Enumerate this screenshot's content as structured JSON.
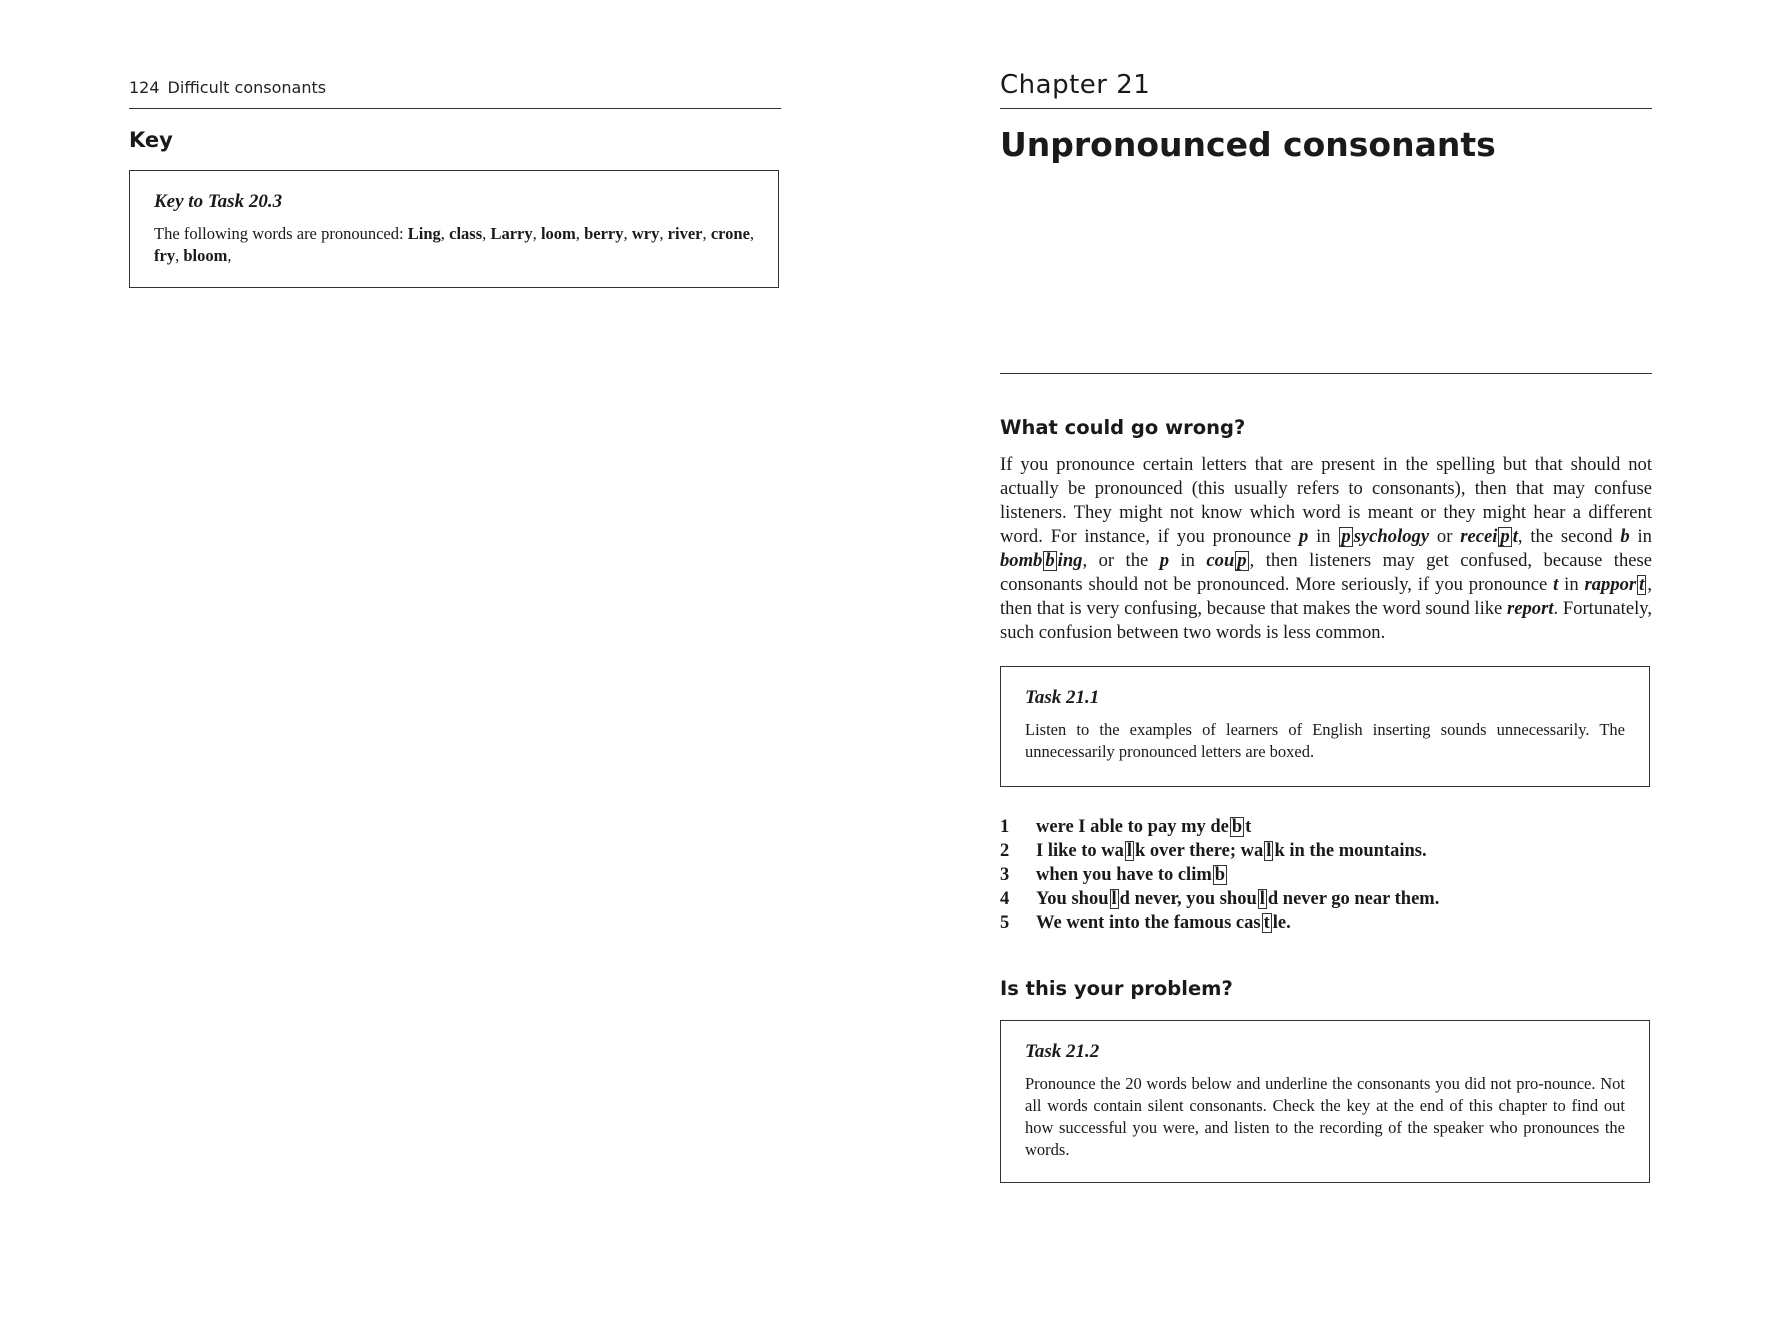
{
  "left_page": {
    "running_head": {
      "page_number": "124",
      "title": "Difficult consonants"
    },
    "key_heading": "Key",
    "key_box": {
      "title": "Key to Task 20.3",
      "intro": "The following words are pronounced: ",
      "words": [
        "Ling",
        "class",
        "Larry",
        "loom",
        "berry",
        "wry",
        "river",
        "crone",
        "fry",
        "bloom"
      ]
    }
  },
  "right_page": {
    "chapter_label": "Chapter 21",
    "chapter_title": "Unpronounced consonants",
    "section1_heading": "What could go wrong?",
    "body": {
      "t1": "If you pronounce certain letters that are present in the spelling but that should not actually be pronounced (this usually refers to consonants), then that may confuse listeners. They might not know which word is meant or they might hear a different word. For instance, if you pronounce ",
      "p1": "p",
      "t2": " in ",
      "w1_box": "p",
      "w1_rest": "sychology",
      "t3": " or ",
      "w2_a": "recei",
      "w2_box": "p",
      "w2_b": "t",
      "t4": ", the second ",
      "b1": "b",
      "t5": " in ",
      "w3_a": "bomb",
      "w3_box": "b",
      "w3_b": "ing",
      "t6": ", or the ",
      "p2": "p",
      "t7": " in ",
      "w4_a": "cou",
      "w4_box": "p",
      "t8": ", then listeners may get confused, because these consonants should not be pronounced. More seriously, if you pronounce ",
      "t_letter": "t",
      "t9": " in ",
      "w5_a": "rappor",
      "w5_box": "t",
      "t10": ", then that is very confusing, because that makes the word sound like ",
      "w6": "report",
      "t11": ". Fortunately, such confusion between two words is less common."
    },
    "task_21_1": {
      "title": "Task 21.1",
      "text": "Listen to the examples of learners of English inserting sounds unnecessarily. The unnecessarily pronounced letters are boxed."
    },
    "examples": [
      {
        "num": "1",
        "a": "were I able to pay my de",
        "box1": "b",
        "b": "t",
        "box2": null,
        "c": ""
      },
      {
        "num": "2",
        "a": "I like to wa",
        "box1": "l",
        "b": "k over there; wa",
        "box2": "l",
        "c": "k in the mountains."
      },
      {
        "num": "3",
        "a": "when you have to clim",
        "box1": "b",
        "b": "",
        "box2": null,
        "c": ""
      },
      {
        "num": "4",
        "a": "You shou",
        "box1": "l",
        "b": "d never, you shou",
        "box2": "l",
        "c": "d never go near them."
      },
      {
        "num": "5",
        "a": "We went into the famous cas",
        "box1": "t",
        "b": "le.",
        "box2": null,
        "c": ""
      }
    ],
    "section2_heading": "Is this your problem?",
    "task_21_2": {
      "title": "Task 21.2",
      "text": "Pronounce the 20 words below and underline the consonants you did not pro-nounce. Not all words contain silent consonants. Check the key at the end of this chapter to find out how successful you were, and listen to the recording of the speaker who pronounces the words."
    }
  }
}
